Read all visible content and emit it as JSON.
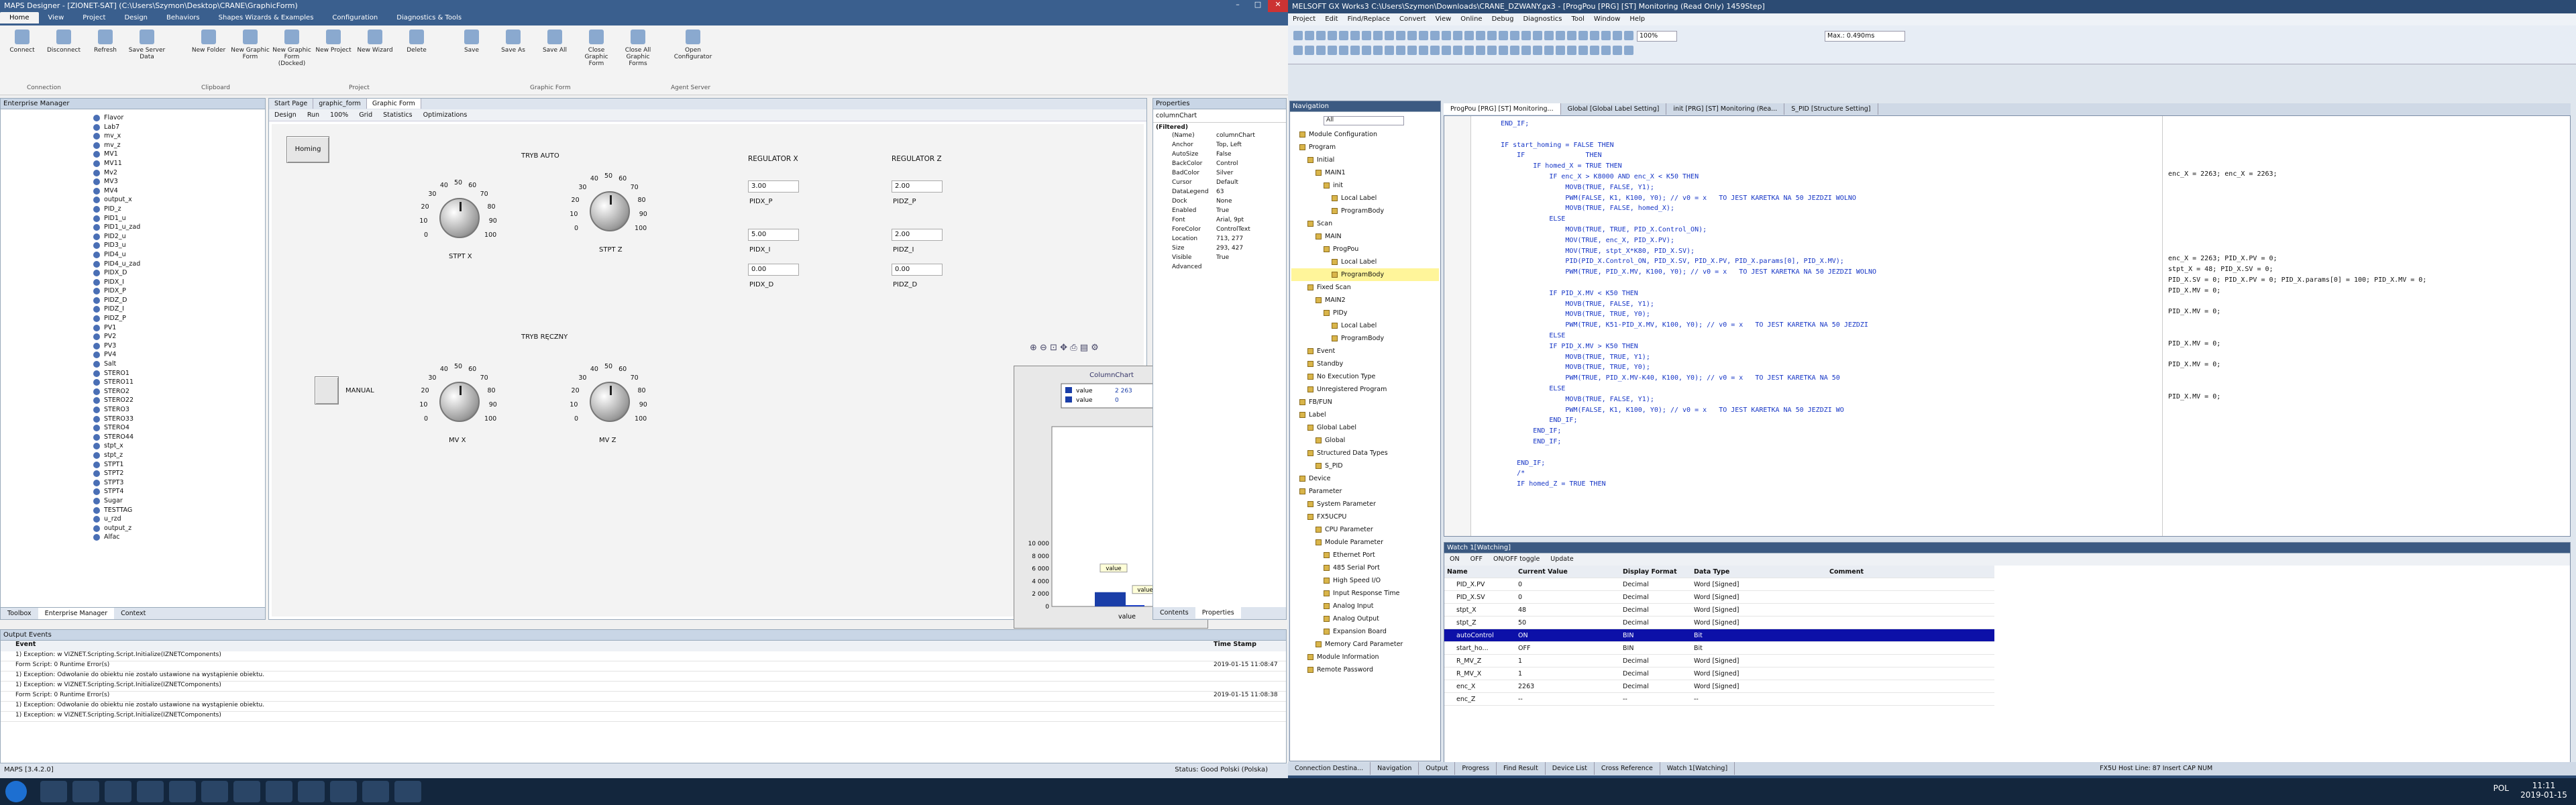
{
  "left": {
    "title": "MAPS Designer - [ZIONET-SAT] (C:\\Users\\Szymon\\Desktop\\CRANE\\GraphicForm)",
    "ribbon_tabs": [
      "Home",
      "View",
      "Project",
      "Design",
      "Behaviors",
      "Shapes Wizards & Examples",
      "Configuration",
      "Diagnostics & Tools"
    ],
    "ribbon_buttons": [
      "Connect",
      "Disconnect",
      "Refresh",
      "Save Server Data",
      "New Folder",
      "New Graphic Form",
      "New Graphic Form (Docked)",
      "New Project",
      "New Wizard",
      "Delete",
      "Save",
      "Save As",
      "Save All",
      "Close Graphic Form",
      "Close All Graphic Forms",
      "Open Configurator"
    ],
    "ribbon_groups": [
      "Connection",
      "Clipboard",
      "Project",
      "Graphic Form",
      "Agent Server"
    ],
    "em_title": "Enterprise Manager",
    "tree_items": [
      "Flavor",
      "Lab7",
      "mv_x",
      "mv_z",
      "MV1",
      "MV11",
      "Mv2",
      "MV3",
      "MV4",
      "output_x",
      "PID_z",
      "PID1_u",
      "PID1_u_zad",
      "PID2_u",
      "PID3_u",
      "PID4_u",
      "PID4_u_zad",
      "PIDX_D",
      "PIDX_I",
      "PIDX_P",
      "PIDZ_D",
      "PIDZ_I",
      "PIDZ_P",
      "PV1",
      "PV2",
      "PV3",
      "PV4",
      "Salt",
      "STERO1",
      "STERO11",
      "STERO2",
      "STERO22",
      "STERO3",
      "STERO33",
      "STERO4",
      "STERO44",
      "stpt_x",
      "stpt_z",
      "STPT1",
      "STPT2",
      "STPT3",
      "STPT4",
      "Sugar",
      "TESTTAG",
      "u_rzd",
      "output_z",
      "Alfac"
    ],
    "em_tabs": [
      "Toolbox",
      "Enterprise Manager",
      "Context"
    ],
    "doc_tabs": [
      "Start Page",
      "graphic_form",
      "Graphic Form"
    ],
    "toolbar": [
      "Design",
      "Run",
      "100%",
      "Grid",
      "Statistics",
      "Optimizations"
    ],
    "homing": "Homing",
    "tryb_auto": "TRYB AUTO",
    "tryb_reczny": "TRYB RĘCZNY",
    "manual": "MANUAL",
    "knobs": [
      {
        "label": "STPT X",
        "ticks": [
          "40",
          "50",
          "60",
          "30",
          "70",
          "20",
          "80",
          "10",
          "90",
          "0",
          "100"
        ]
      },
      {
        "label": "STPT Z",
        "ticks": [
          "40",
          "50",
          "60",
          "30",
          "70",
          "20",
          "80",
          "10",
          "90",
          "0",
          "100"
        ]
      },
      {
        "label": "MV X",
        "ticks": [
          "40",
          "50",
          "60",
          "30",
          "70",
          "20",
          "80",
          "10",
          "90",
          "0",
          "100"
        ]
      },
      {
        "label": "MV Z",
        "ticks": [
          "40",
          "50",
          "60",
          "30",
          "70",
          "20",
          "80",
          "10",
          "90",
          "0",
          "100"
        ]
      }
    ],
    "reg_x": {
      "title": "REGULATOR X",
      "p_val": "3.00",
      "p": "PIDX_P",
      "i_val": "5.00",
      "i": "PIDX_I",
      "d_val": "0.00",
      "d": "PIDX_D"
    },
    "reg_z": {
      "title": "REGULATOR Z",
      "p_val": "2.00",
      "p": "PIDZ_P",
      "i_val": "2.00",
      "i": "PIDZ_I",
      "d_val": "0.00",
      "d": "PIDZ_D"
    },
    "props_title": "Properties",
    "props_object": "columnChart",
    "props": [
      [
        "(Name)",
        "columnChart"
      ],
      [
        "Anchor",
        "Top, Left"
      ],
      [
        "AutoSize",
        "False"
      ],
      [
        "BackColor",
        "Control"
      ],
      [
        "BadColor",
        "Silver"
      ],
      [
        "Cursor",
        "Default"
      ],
      [
        "DataLegend",
        "63"
      ],
      [
        "Dock",
        "None"
      ],
      [
        "Enabled",
        "True"
      ],
      [
        "Font",
        "Arial, 9pt"
      ],
      [
        "ForeColor",
        "ControlText"
      ],
      [
        "Location",
        "713, 277"
      ],
      [
        "Size",
        "293, 427"
      ],
      [
        "Visible",
        "True"
      ],
      [
        "Advanced",
        ""
      ]
    ],
    "props_filter": "(Filtered)",
    "props_tabs": [
      "Contents",
      "Properties"
    ],
    "output_title": "Output Events",
    "output_cols": [
      "Event",
      "Time Stamp"
    ],
    "output_rows": [
      {
        "text": "1) Exception:   w VIZNET.Scripting.Script.Initialize(IZNETComponents)",
        "time": ""
      },
      {
        "text": "Form Script: 0 Runtime Error(s)",
        "time": "2019-01-15 11:08:47"
      },
      {
        "text": "1) Exception:  Odwołanie do obiektu nie zostało ustawione na wystąpienie obiektu.",
        "time": ""
      },
      {
        "text": "1) Exception:   w VIZNET.Scripting.Script.Initialize(IZNETComponents)",
        "time": ""
      },
      {
        "text": "Form Script: 0 Runtime Error(s)",
        "time": "2019-01-15 11:08:38"
      },
      {
        "text": "1) Exception:  Odwołanie do obiektu nie zostało ustawione na wystąpienie obiektu.",
        "time": ""
      },
      {
        "text": "1) Exception:   w VIZNET.Scripting.Script.Initialize(IZNETComponents)",
        "time": ""
      }
    ],
    "status": "MAPS    [3.4.2.0]",
    "status_right": "Status: Good     Polski (Polska)"
  },
  "chart_data": {
    "type": "bar",
    "title": "ColumnChart",
    "categories": [
      "value"
    ],
    "series": [
      {
        "name": "value",
        "values": [
          2263
        ]
      },
      {
        "name": "value",
        "values": [
          0
        ]
      }
    ],
    "legend_values": [
      "2 263",
      "0"
    ],
    "yticks": [
      "10 000",
      "8 000",
      "6 000",
      "4 000",
      "2 000",
      "0"
    ],
    "ylim": [
      0,
      10000
    ],
    "data_labels": [
      "value",
      "value"
    ],
    "xlabel": "value",
    "colors": {
      "bar1": "#1a3ea8",
      "bar2": "#2244c8"
    }
  },
  "right": {
    "title": "MELSOFT GX Works3 C:\\Users\\Szymon\\Downloads\\CRANE_DZWANY.gx3 - [ProgPou [PRG] [ST] Monitoring (Read Only) 1459Step]",
    "menu": [
      "Project",
      "Edit",
      "Find/Replace",
      "Convert",
      "View",
      "Online",
      "Debug",
      "Diagnostics",
      "Tool",
      "Window",
      "Help"
    ],
    "zoom": "100%",
    "scan": "Max.: 0.490ms",
    "nav_title": "Navigation",
    "nav_filter": "All",
    "nav_items": [
      {
        "t": "Module Configuration",
        "l": 1
      },
      {
        "t": "Program",
        "l": 1
      },
      {
        "t": "Initial",
        "l": 2
      },
      {
        "t": "MAIN1",
        "l": 3
      },
      {
        "t": "init",
        "l": 4
      },
      {
        "t": "Local Label",
        "l": 5
      },
      {
        "t": "ProgramBody",
        "l": 5
      },
      {
        "t": "Scan",
        "l": 2
      },
      {
        "t": "MAIN",
        "l": 3
      },
      {
        "t": "ProgPou",
        "l": 4
      },
      {
        "t": "Local Label",
        "l": 5
      },
      {
        "t": "ProgramBody",
        "l": 5,
        "sel": true
      },
      {
        "t": "Fixed Scan",
        "l": 2
      },
      {
        "t": "MAIN2",
        "l": 3
      },
      {
        "t": "PIDy",
        "l": 4
      },
      {
        "t": "Local Label",
        "l": 5
      },
      {
        "t": "ProgramBody",
        "l": 5
      },
      {
        "t": "Event",
        "l": 2
      },
      {
        "t": "Standby",
        "l": 2
      },
      {
        "t": "No Execution Type",
        "l": 2
      },
      {
        "t": "Unregistered Program",
        "l": 2
      },
      {
        "t": "FB/FUN",
        "l": 1
      },
      {
        "t": "Label",
        "l": 1
      },
      {
        "t": "Global Label",
        "l": 2
      },
      {
        "t": "Global",
        "l": 3
      },
      {
        "t": "Structured Data Types",
        "l": 2
      },
      {
        "t": "S_PID",
        "l": 3
      },
      {
        "t": "Device",
        "l": 1
      },
      {
        "t": "Parameter",
        "l": 1
      },
      {
        "t": "System Parameter",
        "l": 2
      },
      {
        "t": "FX5UCPU",
        "l": 2
      },
      {
        "t": "CPU Parameter",
        "l": 3
      },
      {
        "t": "Module Parameter",
        "l": 3
      },
      {
        "t": "Ethernet Port",
        "l": 4
      },
      {
        "t": "485 Serial Port",
        "l": 4
      },
      {
        "t": "High Speed I/O",
        "l": 4
      },
      {
        "t": "Input Response Time",
        "l": 4
      },
      {
        "t": "Analog Input",
        "l": 4
      },
      {
        "t": "Analog Output",
        "l": 4
      },
      {
        "t": "Expansion Board",
        "l": 4
      },
      {
        "t": "Memory Card Parameter",
        "l": 3
      },
      {
        "t": "Module Information",
        "l": 2
      },
      {
        "t": "Remote Password",
        "l": 2
      }
    ],
    "editor_tabs": [
      "ProgPou [PRG] [ST] Monitoring...",
      "Global [Global Label Setting]",
      "init [PRG] [ST] Monitoring (Rea...",
      "S_PID [Structure Setting]"
    ],
    "code": [
      {
        "n": "52",
        "c": "    END_IF;"
      },
      {
        "n": "53",
        "c": ""
      },
      {
        "n": "54",
        "c": "    IF start_homing = FALSE THEN"
      },
      {
        "n": "55",
        "c": "        IF               THEN"
      },
      {
        "n": "56",
        "c": "            IF homed_X = TRUE THEN"
      },
      {
        "n": "57",
        "c": "                IF enc_X > K8000 AND enc_X < K50 THEN"
      },
      {
        "n": "58",
        "c": "                    MOVB(TRUE, FALSE, Y1);"
      },
      {
        "n": "59",
        "c": "                    PWM(FALSE, K1, K100, Y0); // v0 = x   TO JEST KARETKA NA 50 JEZDZI WOLNO"
      },
      {
        "n": "60",
        "c": "                    MOVB(TRUE, FALSE, homed_X);"
      },
      {
        "n": "61",
        "c": "                ELSE"
      },
      {
        "n": "62",
        "c": "                    MOVB(TRUE, TRUE, PID_X.Control_ON);"
      },
      {
        "n": "63",
        "c": "                    MOV(TRUE, enc_X, PID_X.PV);"
      },
      {
        "n": "64",
        "c": "                    MOV(TRUE, stpt_X*K80, PID_X.SV);"
      },
      {
        "n": "65",
        "c": "                    PID(PID_X.Control_ON, PID_X.SV, PID_X.PV, PID_X.params[0], PID_X.MV);"
      },
      {
        "n": "66",
        "c": "                    PWM(TRUE, PID_X.MV, K100, Y0); // v0 = x   TO JEST KARETKA NA 50 JEZDZI WOLNO"
      },
      {
        "n": "67",
        "c": ""
      },
      {
        "n": "68",
        "c": "                IF PID_X.MV < K50 THEN"
      },
      {
        "n": "69",
        "c": "                    MOVB(TRUE, FALSE, Y1);"
      },
      {
        "n": "70",
        "c": "                    MOVB(TRUE, TRUE, Y0);"
      },
      {
        "n": "71",
        "c": "                    PWM(TRUE, K51-PID_X.MV, K100, Y0); // v0 = x   TO JEST KARETKA NA 50 JEZDZI"
      },
      {
        "n": "72",
        "c": "                ELSE"
      },
      {
        "n": "73",
        "c": "                IF PID_X.MV > K50 THEN"
      },
      {
        "n": "74",
        "c": "                    MOVB(TRUE, TRUE, Y1);"
      },
      {
        "n": "75",
        "c": "                    MOVB(TRUE, TRUE, Y0);"
      },
      {
        "n": "76",
        "c": "                    PWM(TRUE, PID_X.MV-K40, K100, Y0); // v0 = x   TO JEST KARETKA NA 50"
      },
      {
        "n": "77",
        "c": "                ELSE"
      },
      {
        "n": "78",
        "c": "                    MOVB(TRUE, FALSE, Y1);"
      },
      {
        "n": "79",
        "c": "                    PWM(FALSE, K1, K100, Y0); // v0 = x   TO JEST KARETKA NA 50 JEZDZI WO"
      },
      {
        "n": "80",
        "c": "                END_IF;"
      },
      {
        "n": "81",
        "c": "            END_IF;"
      },
      {
        "n": "82",
        "c": "            END_IF;"
      },
      {
        "n": "83",
        "c": ""
      },
      {
        "n": "84",
        "c": "        END_IF;"
      },
      {
        "n": "85",
        "c": "        /*"
      },
      {
        "n": "86",
        "c": "        IF homed_Z = TRUE THEN"
      }
    ],
    "monitor": [
      "",
      "",
      "",
      "",
      "",
      "enc_X = 2263; enc_X = 2263;",
      "",
      "",
      "",
      "",
      "",
      "",
      "",
      "enc_X = 2263; PID_X.PV = 0;",
      "stpt_X = 48; PID_X.SV = 0;",
      "PID_X.SV = 0; PID_X.PV = 0; PID_X.params[0] = 100; PID_X.MV = 0;",
      "PID_X.MV = 0;",
      "",
      "PID_X.MV = 0;",
      "",
      "",
      "PID_X.MV = 0;",
      "",
      "PID_X.MV = 0;",
      "",
      "",
      "PID_X.MV = 0;"
    ],
    "watch_title": "Watch 1[Watching]",
    "watch_toolbar": [
      "ON",
      "OFF",
      "ON/OFF toggle",
      "Update"
    ],
    "watch_cols": [
      "Name",
      "Current Value",
      "Display Format",
      "Data Type",
      "Comment"
    ],
    "watch_rows": [
      {
        "name": "PID_X.PV",
        "val": "0",
        "fmt": "Decimal",
        "type": "Word [Signed]"
      },
      {
        "name": "PID_X.SV",
        "val": "0",
        "fmt": "Decimal",
        "type": "Word [Signed]"
      },
      {
        "name": "stpt_X",
        "val": "48",
        "fmt": "Decimal",
        "type": "Word [Signed]"
      },
      {
        "name": "stpt_Z",
        "val": "50",
        "fmt": "Decimal",
        "type": "Word [Signed]"
      },
      {
        "name": "autoControl",
        "val": "ON",
        "fmt": "BIN",
        "type": "Bit",
        "sel": true
      },
      {
        "name": "start_ho...",
        "val": "OFF",
        "fmt": "BIN",
        "type": "Bit"
      },
      {
        "name": "R_MV_Z",
        "val": "1",
        "fmt": "Decimal",
        "type": "Word [Signed]"
      },
      {
        "name": "R_MV_X",
        "val": "1",
        "fmt": "Decimal",
        "type": "Word [Signed]"
      },
      {
        "name": "enc_X",
        "val": "2263",
        "fmt": "Decimal",
        "type": "Word [Signed]"
      },
      {
        "name": "enc_Z",
        "val": "--",
        "fmt": "--",
        "type": "--"
      }
    ],
    "bottom_tabs": [
      "Connection Destina...",
      "Navigation",
      "Output",
      "Progress",
      "Find Result",
      "Device List",
      "Cross Reference",
      "Watch 1[Watching]"
    ],
    "status": [
      "FX5U",
      "Host",
      "Line: 87",
      "Insert",
      "CAP",
      "NUM"
    ]
  },
  "taskbar": {
    "time": "11:11",
    "date": "2019-01-15",
    "lang": "POL"
  }
}
